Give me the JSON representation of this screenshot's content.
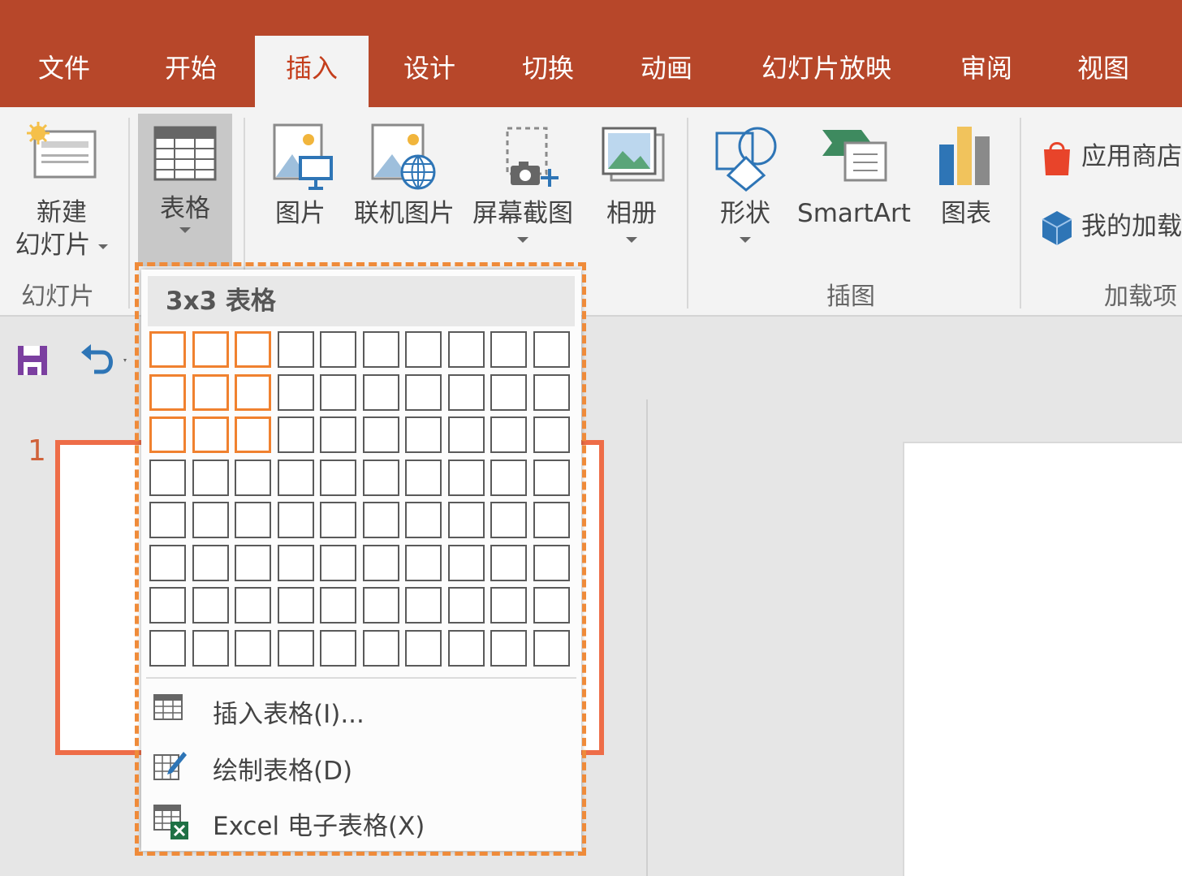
{
  "tabs": [
    {
      "label": "文件",
      "active": false
    },
    {
      "label": "开始",
      "active": false
    },
    {
      "label": "插入",
      "active": true
    },
    {
      "label": "设计",
      "active": false
    },
    {
      "label": "切换",
      "active": false
    },
    {
      "label": "动画",
      "active": false
    },
    {
      "label": "幻灯片放映",
      "active": false
    },
    {
      "label": "审阅",
      "active": false
    },
    {
      "label": "视图",
      "active": false
    }
  ],
  "ribbon": {
    "slides": {
      "new_slide_line1": "新建",
      "new_slide_line2": "幻灯片",
      "group": "幻灯片"
    },
    "tables": {
      "table": "表格"
    },
    "images": {
      "picture": "图片",
      "online_picture": "联机图片",
      "screenshot": "屏幕截图",
      "album": "相册"
    },
    "illustrations": {
      "shapes": "形状",
      "smartart": "SmartArt",
      "chart": "图表",
      "group": "插图"
    },
    "addins": {
      "store": "应用商店",
      "my_addins": "我的加载项",
      "group": "加载项"
    }
  },
  "thumbnail": {
    "slide_number": "1"
  },
  "dropdown": {
    "header": "3x3 表格",
    "grid": {
      "columns": 10,
      "rows": 8,
      "selected_columns": 3,
      "selected_rows": 3
    },
    "items": [
      {
        "label": "插入表格(I)...",
        "icon": "insert-table-icon"
      },
      {
        "label": "绘制表格(D)",
        "icon": "draw-table-icon"
      },
      {
        "label": "Excel 电子表格(X)",
        "icon": "excel-spreadsheet-icon"
      }
    ]
  },
  "colors": {
    "brand": "#b7472a",
    "active_tab_text": "#c43e1c",
    "selection": "#f0812f",
    "highlight_outline": "#ef8b3a",
    "thumbnail_border": "#ee6d48"
  }
}
